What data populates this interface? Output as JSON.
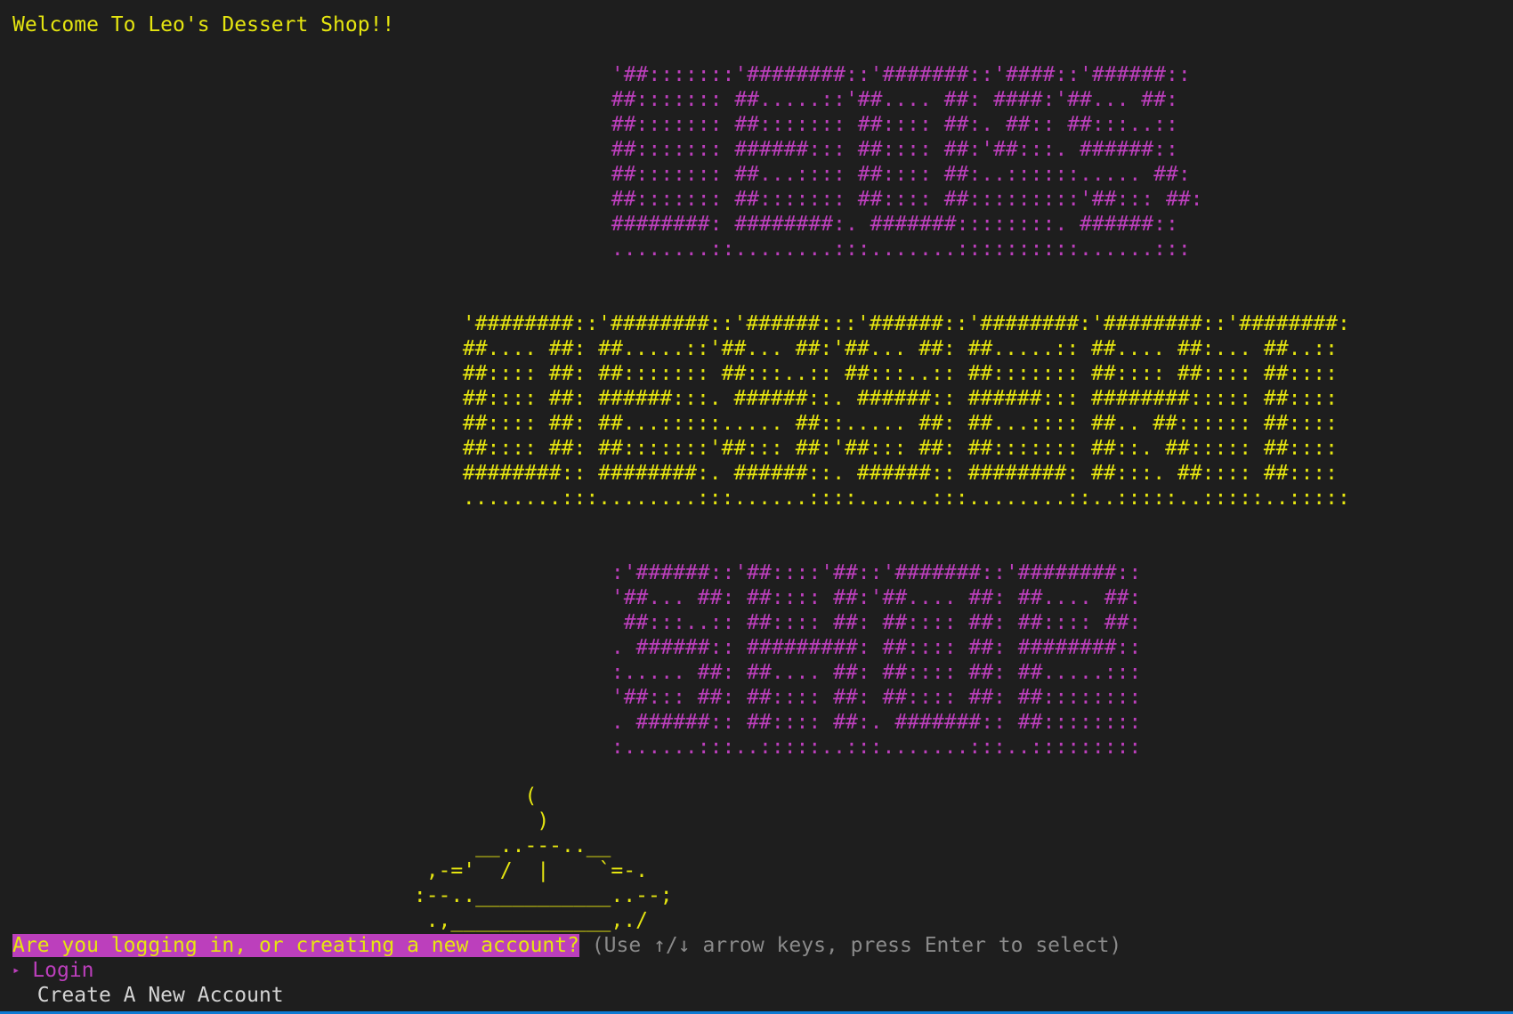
{
  "terminal": {
    "welcome": "Welcome To Leo's Dessert Shop!!",
    "banner_leos": " '##:::::::'########::'#######::'####::'######::\n ##::::::: ##.....::'##.... ##: ####:'##... ##:\n ##::::::: ##::::::: ##:::: ##:. ##:: ##:::..::\n ##::::::: ######::: ##:::: ##:'##:::. ######::\n ##::::::: ##...:::: ##:::: ##:..::::::..... ##:\n ##::::::: ##::::::: ##:::: ##:::::::::'##::: ##:\n ########: ########:. #######::::::::. ######::\n ........::........:::.......::::::::::......:::",
    "banner_dessert": " '########::'########::'######:::'######::'########:'########::'########:\n ##.... ##: ##.....::'##... ##:'##... ##: ##.....:: ##.... ##:... ##..::\n ##:::: ##: ##::::::: ##:::..:: ##:::..:: ##::::::: ##:::: ##:::: ##::::\n ##:::: ##: ######:::. ######::. ######:: ######::: ########::::: ##::::\n ##:::: ##: ##...:::::..... ##::..... ##: ##...:::: ##.. ##:::::: ##::::\n ##:::: ##: ##:::::::'##::: ##:'##::: ##: ##::::::: ##::. ##::::: ##::::\n ########:: ########:. ######::. ######:: ########: ##:::. ##:::: ##::::\n ........:::........:::......::::......:::........::..:::::..:::::..:::::",
    "banner_shop": " :'######::'##::::'##::'#######::'########::\n '##... ##: ##:::: ##:'##.... ##: ##.... ##:\n  ##:::..:: ##:::: ##: ##:::: ##: ##:::: ##:\n . ######:: #########: ##:::: ##: ########::\n :..... ##: ##.... ##: ##:::: ##: ##.....:::\n '##::: ##: ##:::: ##: ##:::: ##: ##::::::::\n . ######:: ##:::: ##:. #######:: ##::::::::\n :......:::..:::::..:::.......:::..:::::::::",
    "dessert_art": "          (\n           )\n      __..---..__\n  ,-='  /  |    `=-.\n :--..___________..--;\n  .,_____________,./",
    "prompt_question": "Are you logging in, or creating a new account?",
    "prompt_hint": " (Use ↑/↓ arrow keys, press Enter to select)",
    "pointer_glyph": "▸",
    "options": [
      {
        "label": "Login",
        "selected": true
      },
      {
        "label": "Create A New Account",
        "selected": false
      }
    ]
  },
  "colors": {
    "background": "#1e1e1e",
    "yellow": "#e5e510",
    "magenta": "#bc3fbc",
    "hint_grey": "#8a8a8a",
    "option_white": "#d4d4d4",
    "status_blue": "#0e7ad3"
  }
}
